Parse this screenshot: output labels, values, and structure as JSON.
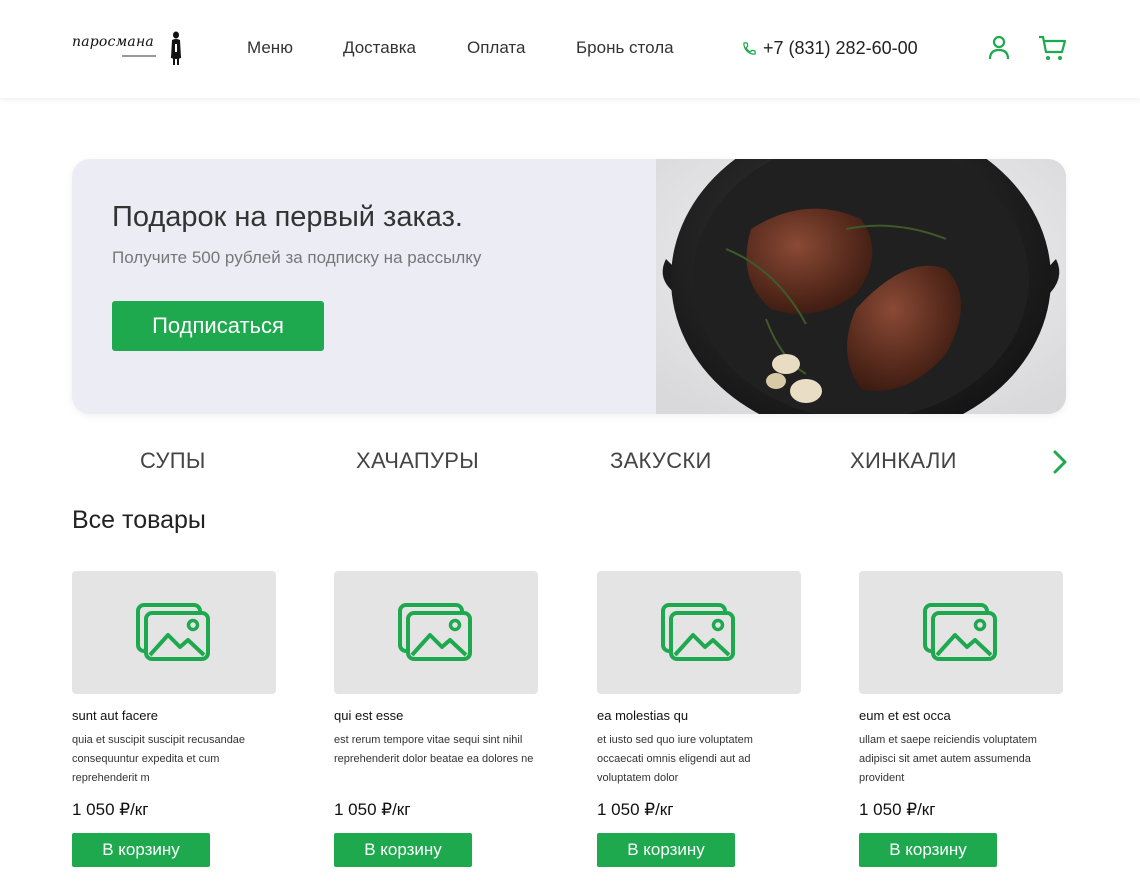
{
  "header": {
    "logo_text": "паросмана",
    "nav": [
      "Меню",
      "Доставка",
      "Оплата",
      "Бронь стола"
    ],
    "phone": "+7 (831) 282-60-00",
    "accent_color": "#1fa94f"
  },
  "banner": {
    "title": "Подарок на первый заказ.",
    "subtitle": "Получите 500 рублей за подписку на рассылку",
    "button_label": "Подписаться"
  },
  "categories": [
    "СУПЫ",
    "ХАЧАПУРЫ",
    "ЗАКУСКИ",
    "ХИНКАЛИ"
  ],
  "section_title": "Все товары",
  "products": [
    {
      "title": "sunt aut facere",
      "description": "quia et suscipit suscipit recusandae consequuntur expedita et cum reprehenderit m",
      "price": "1 050 ₽/кг",
      "button_label": "В корзину"
    },
    {
      "title": "qui est esse",
      "description": "est rerum tempore vitae sequi sint nihil reprehenderit dolor beatae ea dolores ne",
      "price": "1 050 ₽/кг",
      "button_label": "В корзину"
    },
    {
      "title": "ea molestias qu",
      "description": "et iusto sed quo iure voluptatem occaecati omnis eligendi aut ad voluptatem dolor",
      "price": "1 050 ₽/кг",
      "button_label": "В корзину"
    },
    {
      "title": "eum et est occa",
      "description": "ullam et saepe reiciendis voluptatem adipisci sit amet autem assumenda provident",
      "price": "1 050 ₽/кг",
      "button_label": "В корзину"
    }
  ]
}
